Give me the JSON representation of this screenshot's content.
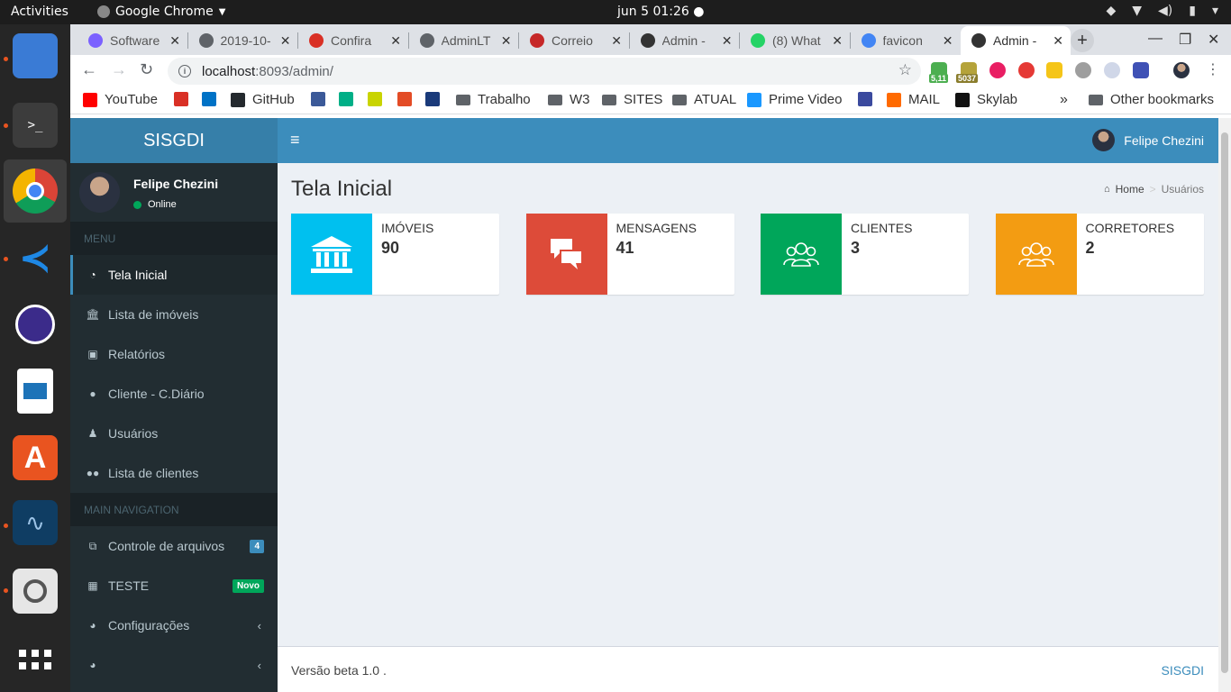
{
  "system": {
    "activities": "Activities",
    "app_name": "Google Chrome",
    "clock": "jun 5  01:26 ●"
  },
  "browser": {
    "tabs": [
      {
        "title": "Software",
        "color": "#7b61ff"
      },
      {
        "title": "2019-10-",
        "color": "#5f6368"
      },
      {
        "title": "Confira",
        "color": "#d93025"
      },
      {
        "title": "AdminLT",
        "color": "#5f6368"
      },
      {
        "title": "Correio",
        "color": "#c62828"
      },
      {
        "title": "Admin -",
        "color": "#333333"
      },
      {
        "title": "(8) What",
        "color": "#25d366"
      },
      {
        "title": "favicon",
        "color": "#4285f4"
      },
      {
        "title": "Admin -",
        "color": "#333333"
      }
    ],
    "url_host": "localhost",
    "url_path": ":8093/admin/",
    "ext_badges": [
      "5,11",
      "5037"
    ],
    "bookmarks": [
      {
        "label": "YouTube",
        "icon": "youtube-icon",
        "color": "#ff0000"
      },
      {
        "label": "",
        "icon": "gmail-icon",
        "color": "#d93025"
      },
      {
        "label": "",
        "icon": "outlook-icon",
        "color": "#0072c6"
      },
      {
        "label": "GitHub",
        "icon": "github-icon",
        "color": "#24292e"
      },
      {
        "label": "",
        "icon": "facebook-icon",
        "color": "#3b5998"
      },
      {
        "label": "",
        "icon": "tripadvisor-icon",
        "color": "#00af87"
      },
      {
        "label": "",
        "icon": "bookmark-icon",
        "color": "#c9d400"
      },
      {
        "label": "",
        "icon": "pdf-icon",
        "color": "#e34c26"
      },
      {
        "label": "",
        "icon": "bank-icon",
        "color": "#1a3a7a"
      },
      {
        "label": "Trabalho",
        "icon": "folder-icon",
        "color": "#5f6368"
      },
      {
        "label": "W3",
        "icon": "folder-icon",
        "color": "#5f6368"
      },
      {
        "label": "SITES",
        "icon": "folder-icon",
        "color": "#5f6368"
      },
      {
        "label": "ATUAL",
        "icon": "folder-icon",
        "color": "#5f6368"
      },
      {
        "label": "Prime Video",
        "icon": "primevideo-icon",
        "color": "#1a98ff"
      },
      {
        "label": "",
        "icon": "figure-icon",
        "color": "#3b4a9e"
      },
      {
        "label": "MAIL",
        "icon": "mail-icon",
        "color": "#ff6a00"
      },
      {
        "label": "Skylab",
        "icon": "skylab-icon",
        "color": "#111111"
      }
    ],
    "more": "»",
    "other_bookmarks": "Other bookmarks"
  },
  "app": {
    "brand": "SISGDI",
    "user_name": "Felipe Chezini",
    "user_status": "Online",
    "menu_header_1": "MENU",
    "menu_header_2": "MAIN NAVIGATION",
    "menu": [
      {
        "label": "Tela Inicial",
        "icon": "dashboard-icon"
      },
      {
        "label": "Lista de imóveis",
        "icon": "bank-icon"
      },
      {
        "label": "Relatórios",
        "icon": "calendar-icon"
      },
      {
        "label": "Cliente - C.Diário",
        "icon": "comments-icon"
      },
      {
        "label": "Usuários",
        "icon": "child-icon"
      },
      {
        "label": "Lista de clientes",
        "icon": "users-icon"
      }
    ],
    "nav": [
      {
        "label": "Controle de arquivos",
        "badge": "4",
        "badge_color": "#3c8dbc"
      },
      {
        "label": "TESTE",
        "badge": "Novo",
        "badge_color": "#00a65a"
      },
      {
        "label": "Configurações",
        "badge": "",
        "badge_color": ""
      },
      {
        "label": "",
        "badge": "",
        "badge_color": ""
      }
    ],
    "page_title": "Tela Inicial",
    "breadcrumb_home": "Home",
    "breadcrumb_sep": ">",
    "breadcrumb_current": "Usuários",
    "info_boxes": [
      {
        "label": "Imóveis",
        "value": "90",
        "color": "#00c0ef",
        "icon": "bank-icon"
      },
      {
        "label": "Mensagens",
        "value": "41",
        "color": "#dd4b39",
        "icon": "comments-icon"
      },
      {
        "label": "Clientes",
        "value": "3",
        "color": "#00a65a",
        "icon": "users-icon"
      },
      {
        "label": "Corretores",
        "value": "2",
        "color": "#f39c12",
        "icon": "users-icon"
      }
    ],
    "footer_version": "Versão beta 1.0 .",
    "footer_brand": "SISGDI"
  }
}
